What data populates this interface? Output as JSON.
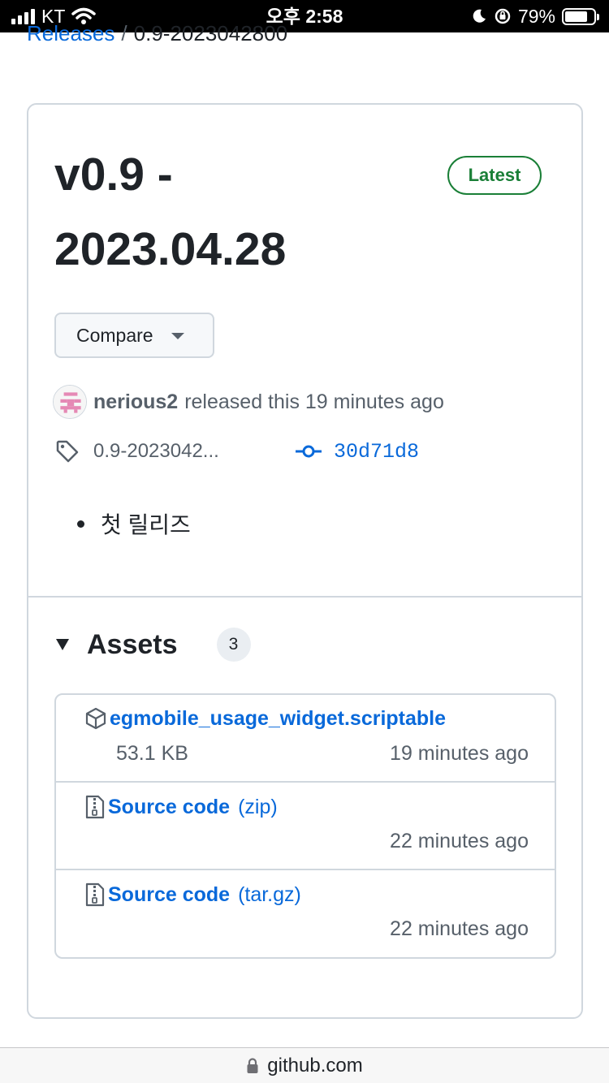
{
  "status_bar": {
    "carrier": "KT",
    "time": "오후 2:58",
    "battery": "79%",
    "battery_level": 0.79
  },
  "breadcrumb": {
    "link": "Releases",
    "separator": "/",
    "current": "0.9-2023042800"
  },
  "release": {
    "title": "v0.9 - 2023.04.28",
    "latest_label": "Latest",
    "compare_label": "Compare",
    "author": "nerious2",
    "released_text": "released this 19 minutes ago",
    "tag": "0.9-2023042...",
    "commit": "30d71d8",
    "notes": [
      "첫 릴리즈"
    ]
  },
  "assets": {
    "title": "Assets",
    "count": "3",
    "items": [
      {
        "name": "egmobile_usage_widget.scriptable",
        "suffix": "",
        "size": "53.1 KB",
        "time": "19 minutes ago",
        "icon": "package-icon"
      },
      {
        "name": "Source code",
        "suffix": "(zip)",
        "size": "",
        "time": "22 minutes ago",
        "icon": "file-zip-icon"
      },
      {
        "name": "Source code",
        "suffix": "(tar.gz)",
        "size": "",
        "time": "22 minutes ago",
        "icon": "file-zip-icon"
      }
    ]
  },
  "url_bar": {
    "domain": "github.com"
  },
  "colors": {
    "link": "#0969da",
    "latest_green": "#1a7f37",
    "muted_text": "#57606a",
    "border": "#d0d7de"
  }
}
